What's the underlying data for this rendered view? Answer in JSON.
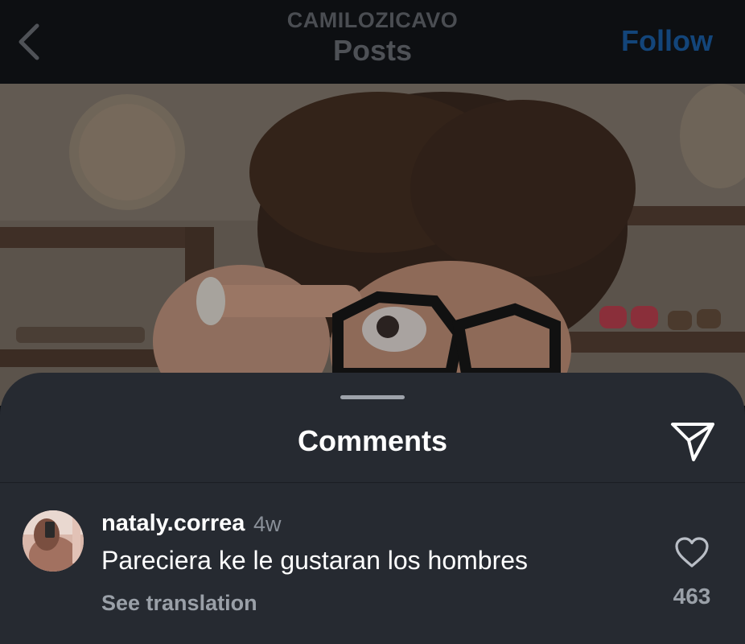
{
  "header": {
    "username": "CAMILOZICAVO",
    "title": "Posts",
    "follow_label": "Follow",
    "back_icon": "chevron-left-icon",
    "follow_color": "#13457a"
  },
  "post": {
    "image": "photo"
  },
  "comments_sheet": {
    "title": "Comments",
    "share_icon": "paper-plane-icon",
    "comments": [
      {
        "username": "nataly.correa",
        "time": "4w",
        "text": "Pareciera ke le gustaran los hombres",
        "translate_label": "See translation",
        "likes": "463",
        "like_icon": "heart-icon"
      }
    ]
  },
  "colors": {
    "sheet_background": "#262a31",
    "header_background": "#0d0f12",
    "text_primary": "#ffffff",
    "text_secondary": "#9aa0a8"
  }
}
